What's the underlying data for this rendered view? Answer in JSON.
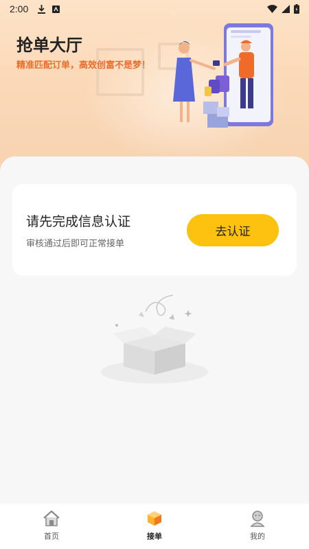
{
  "status_bar": {
    "time": "2:00",
    "left_icons": [
      "download-icon",
      "app-icon"
    ],
    "right_icons": [
      "wifi-icon",
      "signal-icon",
      "battery-charging-icon"
    ]
  },
  "hero": {
    "title": "抢单大厅",
    "subtitle": "精准匹配订单，高效创富不是梦！"
  },
  "verify_card": {
    "title": "请先完成信息认证",
    "subtitle": "审核通过后即可正常接单",
    "button_label": "去认证"
  },
  "empty_state": {
    "icon": "empty-box-icon"
  },
  "tab_bar": {
    "tabs": [
      {
        "label": "首页",
        "icon": "home-icon",
        "active": false
      },
      {
        "label": "接单",
        "icon": "order-box-icon",
        "active": true
      },
      {
        "label": "我的",
        "icon": "profile-icon",
        "active": false
      }
    ]
  },
  "colors": {
    "accent": "#fdc10f",
    "subtitle": "#f06b2a",
    "hero_bg": "#fbd9b8",
    "page_bg": "#f7f7f7"
  }
}
